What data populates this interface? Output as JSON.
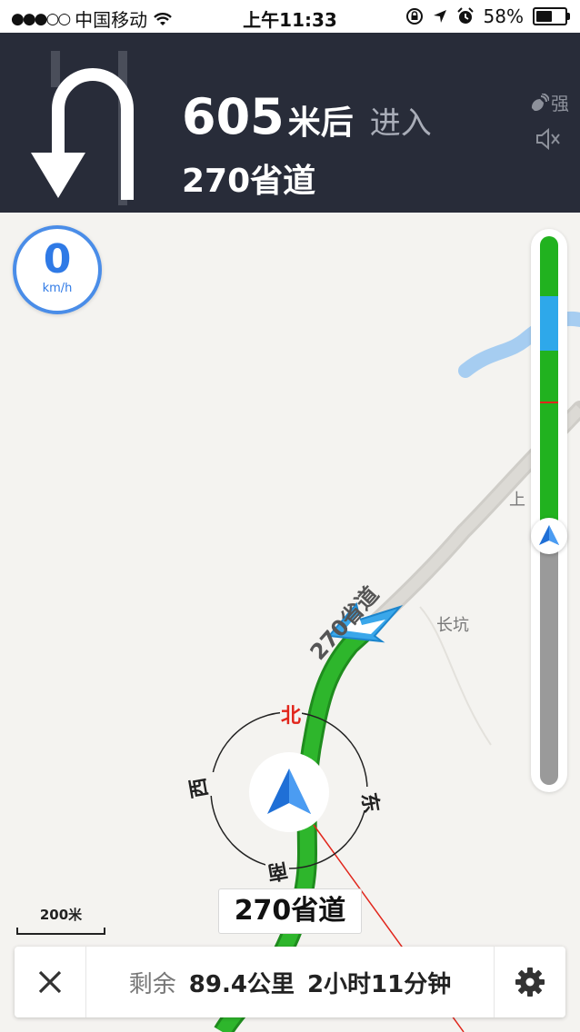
{
  "status_bar": {
    "signal_dots": "●●●○○",
    "carrier": "中国移动",
    "time": "上午11:33",
    "battery_percent": "58%",
    "battery_level": 0.58
  },
  "navigation": {
    "turn_icon": "u-turn-left-icon",
    "distance": "605",
    "distance_unit": "米后",
    "action": "进入",
    "next_road": "270省道",
    "signal_strength_label": "强"
  },
  "map": {
    "speed_value": "0",
    "speed_unit": "km/h",
    "compass": {
      "north": "北",
      "east": "东",
      "south": "南",
      "west": "西"
    },
    "road_name_on_map": "270省道",
    "place_labels": [
      "长坑",
      "上"
    ],
    "scale_label": "200米",
    "current_road_label": "270省道",
    "route_progress_fraction": 0.53
  },
  "bottom_bar": {
    "remaining_label": "剩余",
    "remaining_distance": "89.4公里",
    "remaining_time": "2小时11分钟"
  },
  "colors": {
    "header_bg": "#282c39",
    "route_green": "#2eb62c",
    "route_blue": "#3aa7ea",
    "speed_blue": "#2f7ae6",
    "compass_red": "#e1251b"
  }
}
